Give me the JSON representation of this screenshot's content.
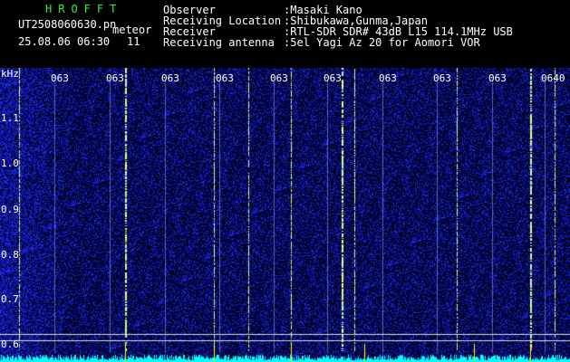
{
  "header": {
    "station_name": "HROFFT",
    "filename": "UT2508060630.pn",
    "mode_label": "meteor",
    "datetime": "25.08.06 06:30",
    "count": "11",
    "fields": [
      {
        "label": "Observer",
        "value": ":Masaki Kano"
      },
      {
        "label": "Receiving Location",
        "value": ":Shibukawa,Gunma,Japan"
      },
      {
        "label": "Receiver",
        "value": ":RTL-SDR SDR# 43dB L15 114.1MHz USB"
      },
      {
        "label": "Receiving antenna",
        "value": ":5el Yagi Az 20 for Aomori VOR"
      }
    ]
  },
  "spectrogram": {
    "y_unit": "kHz",
    "y_ticks": [
      "1.1",
      "1.0",
      "0.9",
      "0.8",
      "0.7",
      "0.6"
    ],
    "time_labels": [
      "063",
      "063",
      "063",
      "063",
      "063",
      "063",
      "063",
      "063",
      "063",
      "0640"
    ],
    "colors": {
      "background": "#000033",
      "noise": "#1a2bd0",
      "meteor": "#ffff66",
      "baseline": "#00ffff"
    }
  }
}
